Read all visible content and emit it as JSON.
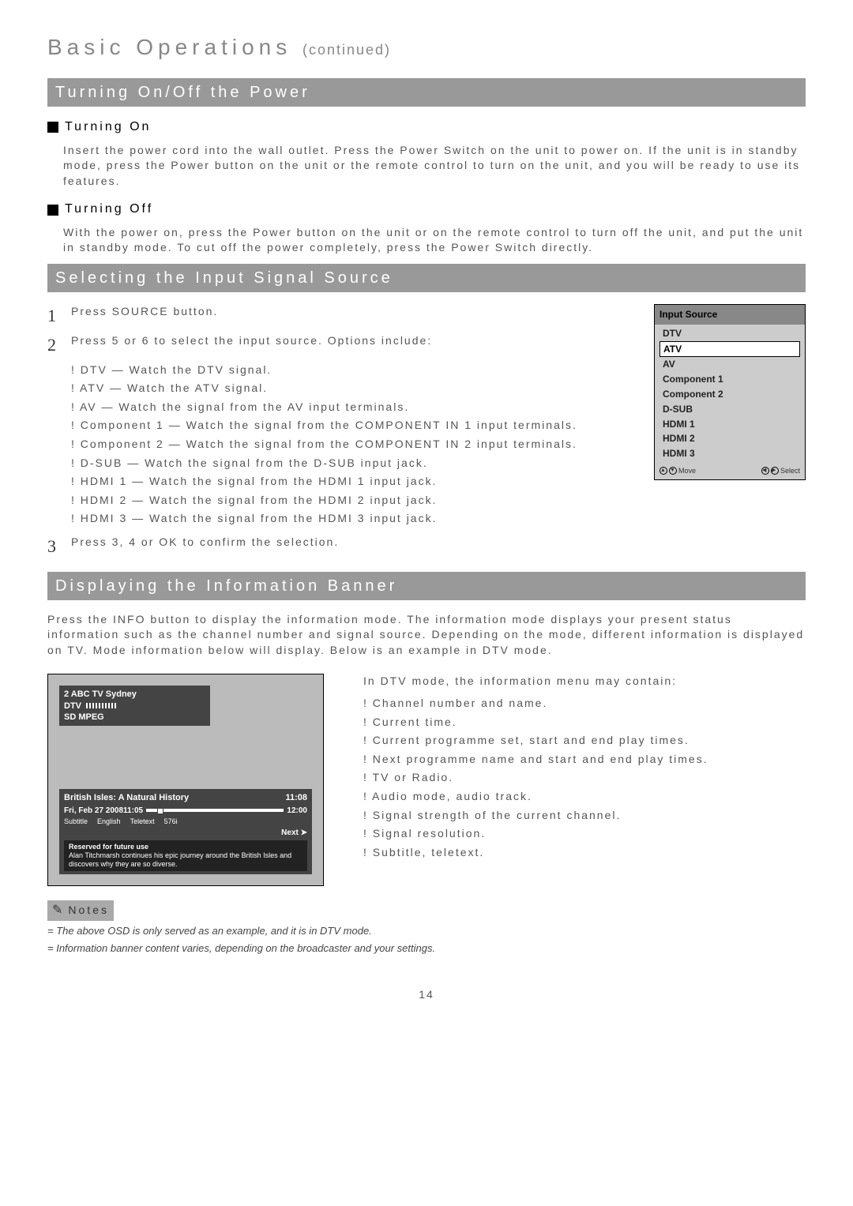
{
  "title_main": "Basic Operations",
  "title_cont": "(continued)",
  "sec1": {
    "header": "Turning On/Off the Power",
    "on_head": "Turning On",
    "on_text": "Insert the power cord into the wall outlet. Press the Power Switch on the unit to power on. If the unit is in standby mode, press the Power button on the unit or the remote control to turn on the unit, and you will be ready to use its features.",
    "off_head": "Turning Off",
    "off_text": "With the power on, press the Power button on the unit or on the remote control to turn off the unit, and put the unit in standby mode. To cut off the power completely, press the Power Switch directly."
  },
  "sec2": {
    "header": "Selecting the Input Signal Source",
    "step1": "Press SOURCE button.",
    "step2": "Press 5 or 6 to select the input source. Options include:",
    "options": [
      "! DTV — Watch the DTV signal.",
      "! ATV — Watch the ATV signal.",
      "! AV — Watch the signal from the AV input terminals.",
      "! Component 1 — Watch the signal from the COMPONENT IN 1 input terminals.",
      "! Component 2 — Watch the signal from the COMPONENT IN 2 input terminals.",
      "! D-SUB — Watch the signal from the D-SUB input jack.",
      "! HDMI 1 — Watch the signal from the HDMI 1 input jack.",
      "! HDMI 2 — Watch the signal from the HDMI 2 input jack.",
      "! HDMI 3 — Watch the signal from the HDMI 3 input jack."
    ],
    "step3": "Press 3, 4 or OK to confirm the selection.",
    "box": {
      "title": "Input Source",
      "items": [
        "DTV",
        "ATV",
        "AV",
        "Component 1",
        "Component 2",
        "D-SUB",
        "HDMI 1",
        "HDMI 2",
        "HDMI 3"
      ],
      "move": "Move",
      "select": "Select"
    }
  },
  "sec3": {
    "header": "Displaying the Information Banner",
    "intro": "Press the INFO button to display the information mode. The information mode displays your present status information such as the channel number and signal source.\nDepending on the mode, different information is displayed on TV. Mode information below will display. Below is an example in DTV mode.",
    "osd": {
      "ch": "2  ABC TV Sydney",
      "dtv": "DTV",
      "sdmpeg": "SD  MPEG",
      "prog": "British Isles: A Natural History",
      "end": "11:08",
      "date": "Fri, Feb 27 2008",
      "t1": "11:05",
      "t2": "12:00",
      "sub": "Subtitle",
      "eng": "English",
      "ttx": "Teletext",
      "res": "576i",
      "next": "Next ➤",
      "desc1": "Reserved for future use",
      "desc2": "Alan Titchmarsh continues his epic journey around the British Isles and discovers why they are so diverse."
    },
    "right_lead": "In DTV mode, the information menu may contain:",
    "bullets": [
      "! Channel number and name.",
      "! Current time.",
      "! Current programme set, start and end play times.",
      "! Next programme name and start and end play times.",
      "! TV or Radio.",
      "! Audio mode, audio track.",
      "! Signal strength of the current channel.",
      "! Signal resolution.",
      "! Subtitle, teletext."
    ]
  },
  "notes": {
    "head": "Notes",
    "n1": "= The above OSD is only served as an example, and it is in DTV mode.",
    "n2": "= Information banner content varies, depending on the broadcaster and your settings."
  },
  "page": "14"
}
